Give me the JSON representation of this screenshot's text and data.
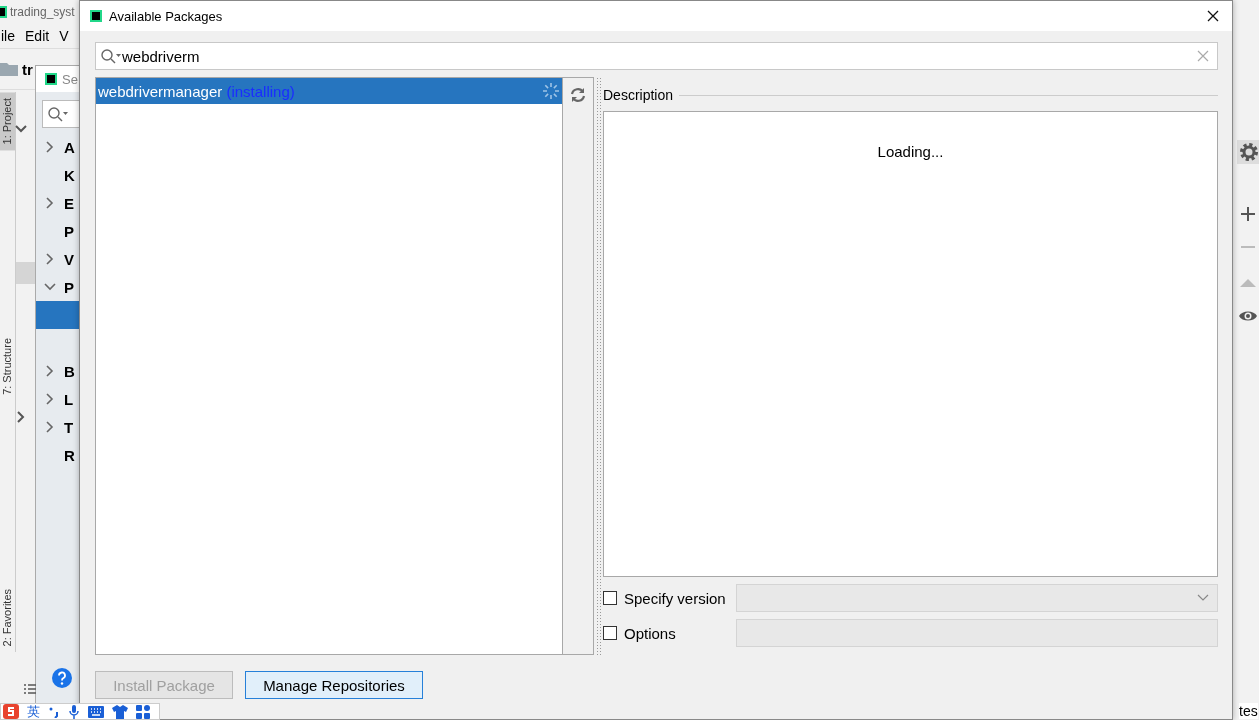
{
  "ide": {
    "title": "trading_syst",
    "menu": [
      "ile",
      "Edit",
      "V"
    ],
    "project": "tr",
    "side_tabs": [
      {
        "label": "1: Project",
        "selected": true
      },
      {
        "label": "7: Structure",
        "selected": false
      },
      {
        "label": "2: Favorites",
        "selected": false
      }
    ],
    "status_text": "tes"
  },
  "settings": {
    "title": "Se",
    "tree": [
      {
        "label": "A",
        "expandable": true,
        "expanded": false
      },
      {
        "label": "K",
        "expandable": false
      },
      {
        "label": "E",
        "expandable": true,
        "expanded": false
      },
      {
        "label": "P",
        "expandable": false
      },
      {
        "label": "V",
        "expandable": true,
        "expanded": false
      },
      {
        "label": "P",
        "expandable": true,
        "expanded": true,
        "children": [
          {
            "selected": true
          }
        ]
      },
      {
        "label": "B",
        "expandable": true,
        "expanded": false
      },
      {
        "label": "L",
        "expandable": true,
        "expanded": false
      },
      {
        "label": "T",
        "expandable": true,
        "expanded": false
      },
      {
        "label": "R",
        "expandable": false
      }
    ]
  },
  "dialog": {
    "title": "Available Packages",
    "search": {
      "value": "webdriverm"
    },
    "packages": [
      {
        "name": "webdrivermanager",
        "status": "(installing)",
        "selected": true
      }
    ],
    "description_label": "Description",
    "description_text": "Loading...",
    "options": [
      {
        "label": "Specify version",
        "checked": false,
        "kind": "dropdown"
      },
      {
        "label": "Options",
        "checked": false,
        "kind": "field"
      }
    ],
    "buttons": [
      {
        "label": "Install Package",
        "disabled": true
      },
      {
        "label": "Manage Repositories",
        "disabled": false
      }
    ]
  },
  "ime": {
    "label": "英"
  }
}
